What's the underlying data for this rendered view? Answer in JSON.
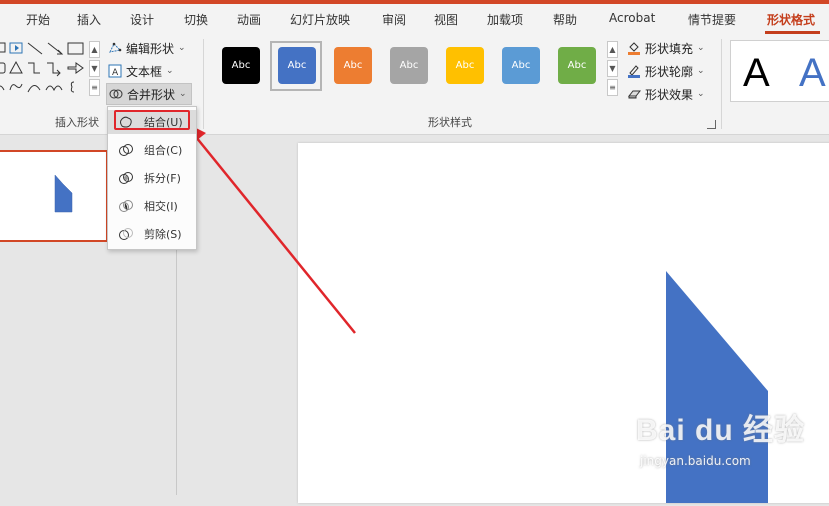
{
  "tabs": [
    "开始",
    "插入",
    "设计",
    "切换",
    "动画",
    "幻灯片放映",
    "审阅",
    "视图",
    "加载项",
    "帮助",
    "Acrobat",
    "情节提要",
    "形状格式"
  ],
  "active_tab": "形状格式",
  "ribbon": {
    "insert_shapes": {
      "label": "插入形状",
      "edit_shape": "编辑形状",
      "text_box": "文本框",
      "merge_shapes": "合并形状"
    },
    "shape_styles": {
      "label": "形状样式",
      "swatches": [
        {
          "text": "Abc",
          "color": "#000000"
        },
        {
          "text": "Abc",
          "color": "#4472c4",
          "selected": true
        },
        {
          "text": "Abc",
          "color": "#ed7d31"
        },
        {
          "text": "Abc",
          "color": "#a5a5a5"
        },
        {
          "text": "Abc",
          "color": "#ffc000"
        },
        {
          "text": "Abc",
          "color": "#5b9bd5"
        },
        {
          "text": "Abc",
          "color": "#70ad47"
        }
      ],
      "fill": "形状填充",
      "outline": "形状轮廓",
      "effects": "形状效果"
    },
    "wordart": {
      "sample_1": "A",
      "sample_2": "A",
      "color_1": "#000000",
      "color_2": "#4472c4"
    }
  },
  "merge_menu": {
    "items": [
      {
        "label": "结合(U)",
        "icon": "union-icon"
      },
      {
        "label": "组合(C)",
        "icon": "combine-icon"
      },
      {
        "label": "拆分(F)",
        "icon": "fragment-icon"
      },
      {
        "label": "相交(I)",
        "icon": "intersect-icon"
      },
      {
        "label": "剪除(S)",
        "icon": "subtract-icon"
      }
    ],
    "selected_item": "结合(U)"
  },
  "colors": {
    "accent": "#c43e1c",
    "shape_fill": "#4472c4",
    "annotation": "#e0262b"
  },
  "watermark": {
    "brand": "Bai du 经验",
    "url": "jingyan.baidu.com"
  }
}
